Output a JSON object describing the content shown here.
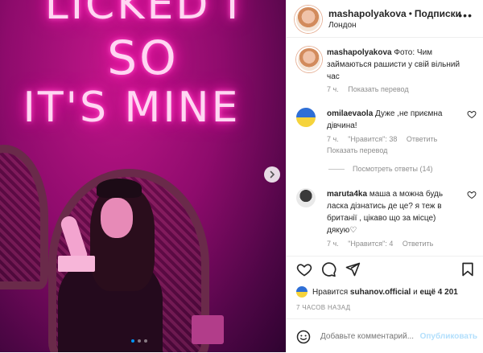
{
  "photo": {
    "neon_line1": "LICKED I",
    "neon_line2": "SO",
    "neon_line3": "IT'S MINE",
    "carousel_dots": 3,
    "active_dot": 1
  },
  "header": {
    "username": "mashapolyakova",
    "separator": "•",
    "follow_label": "Подписки",
    "location": "Лондон"
  },
  "caption": {
    "username": "mashapolyakova",
    "text": "Фото: Чим займаються рашисти у свій вільний час",
    "time": "7 ч.",
    "translate": "Показать перевод"
  },
  "comments": [
    {
      "username": "omilaevaola",
      "text": "Дуже ,не приємна дівчина!",
      "time": "7 ч.",
      "likes": "\"Нравится\": 38",
      "reply": "Ответить",
      "translate": "Показать перевод"
    },
    {
      "username": "maruta4ka",
      "text": "маша а можна будь ласка дізнатись де це? я теж в британії , цікаво що за місце) дякую♡",
      "time": "7 ч.",
      "likes": "\"Нравится\": 4",
      "reply": "Ответить"
    }
  ],
  "view_replies": "Посмотреть ответы (14)",
  "likes_line": {
    "prefix": "Нравится",
    "user": "suhanov.official",
    "and": "и",
    "rest": "ещё 4 201"
  },
  "timestamp": "7 ЧАСОВ НАЗАД",
  "add_comment": {
    "placeholder": "Добавьте комментарий...",
    "post_label": "Опубликовать"
  },
  "colors": {
    "accent": "#0095f6",
    "muted": "#8e8e8e",
    "post_disabled": "#b2dffc"
  },
  "icons": [
    "more-icon",
    "heart-icon",
    "comment-icon",
    "share-icon",
    "bookmark-icon",
    "emoji-icon",
    "next-arrow-icon"
  ]
}
